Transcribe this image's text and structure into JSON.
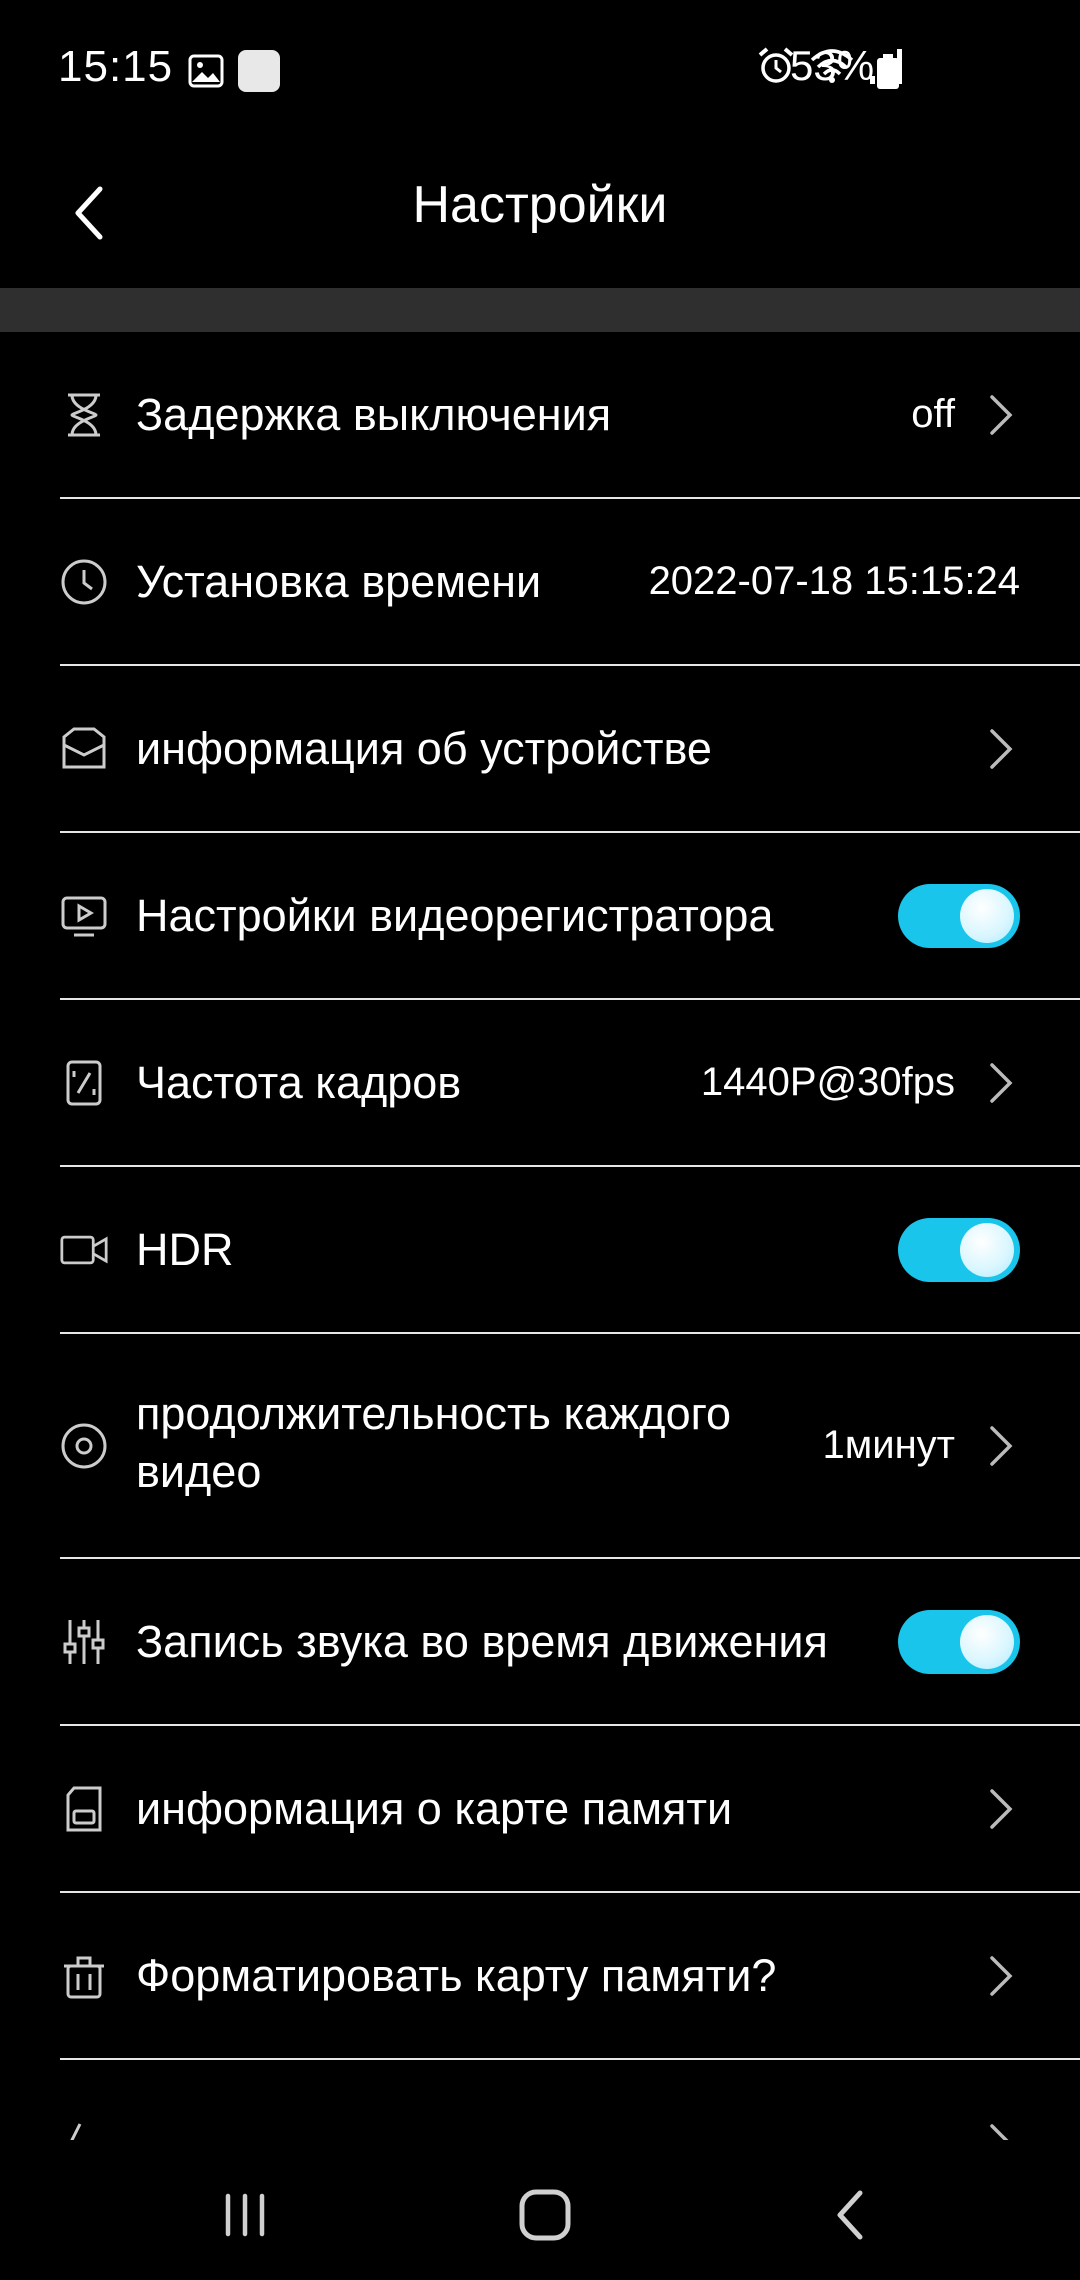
{
  "status_bar": {
    "time": "15:15",
    "battery_percent": "53%"
  },
  "header": {
    "title": "Настройки"
  },
  "settings": [
    {
      "label": "Задержка выключения",
      "value": "off",
      "control": "chevron",
      "icon": "hourglass-icon"
    },
    {
      "label": "Установка времени",
      "value": "2022-07-18 15:15:24",
      "control": "none",
      "icon": "clock-icon"
    },
    {
      "label": "информация об устройстве",
      "value": "",
      "control": "chevron",
      "icon": "device-info-icon"
    },
    {
      "label": "Настройки видеорегистратора",
      "value": "",
      "control": "toggle",
      "on": true,
      "icon": "video-screen-icon"
    },
    {
      "label": "Частота кадров",
      "value": "1440P@30fps",
      "control": "chevron",
      "icon": "frame-rate-icon"
    },
    {
      "label": "HDR",
      "value": "",
      "control": "toggle",
      "on": true,
      "icon": "camera-icon"
    },
    {
      "label_line1": "продолжительность каждого",
      "label_line2": "видео",
      "value": "1минут",
      "control": "chevron",
      "icon": "record-duration-icon"
    },
    {
      "label": "Запись звука во время движения",
      "value": "",
      "control": "toggle",
      "on": true,
      "icon": "sliders-icon"
    },
    {
      "label": "информация о карте памяти",
      "value": "",
      "control": "chevron",
      "icon": "sd-card-icon"
    },
    {
      "label": "Форматировать карту памяти?",
      "value": "",
      "control": "chevron",
      "icon": "trash-icon"
    }
  ],
  "colors": {
    "background": "#000000",
    "toggle_on": "#19c5ea",
    "divider": "#e6e6e6",
    "band": "#2f2f2f"
  }
}
